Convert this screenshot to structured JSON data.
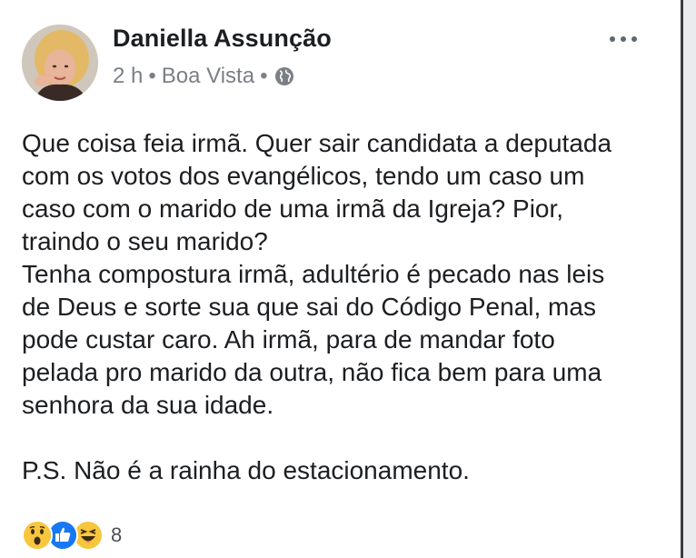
{
  "post": {
    "author": "Daniella Assunção",
    "time": "2 h",
    "separator": "•",
    "location": "Boa Vista",
    "audience_icon": "globe-icon",
    "options_icon": "more-options-icon",
    "body": {
      "lines": [
        "Que coisa feia irmã.  Quer sair candidata a deputada",
        "com os votos dos evangélicos, tendo um caso um",
        "caso com o marido de uma irmã da Igreja? Pior,",
        "traindo o seu marido?",
        "Tenha compostura irmã, adultério é pecado nas leis",
        "de Deus e sorte sua que sai do Código Penal, mas",
        "pode custar caro.  Ah irmã, para de mandar foto",
        "pelada pro marido da outra, não fica bem para uma",
        "senhora da sua idade."
      ],
      "ps": "P.S. Não é a rainha do estacionamento."
    },
    "reactions": {
      "icons": [
        "wow-reaction-icon",
        "like-reaction-icon",
        "haha-reaction-icon"
      ],
      "count": "8"
    }
  },
  "colors": {
    "like_blue": "#1877f2",
    "reaction_yellow": "#f7c63c",
    "meta_gray": "#7b7f86"
  }
}
